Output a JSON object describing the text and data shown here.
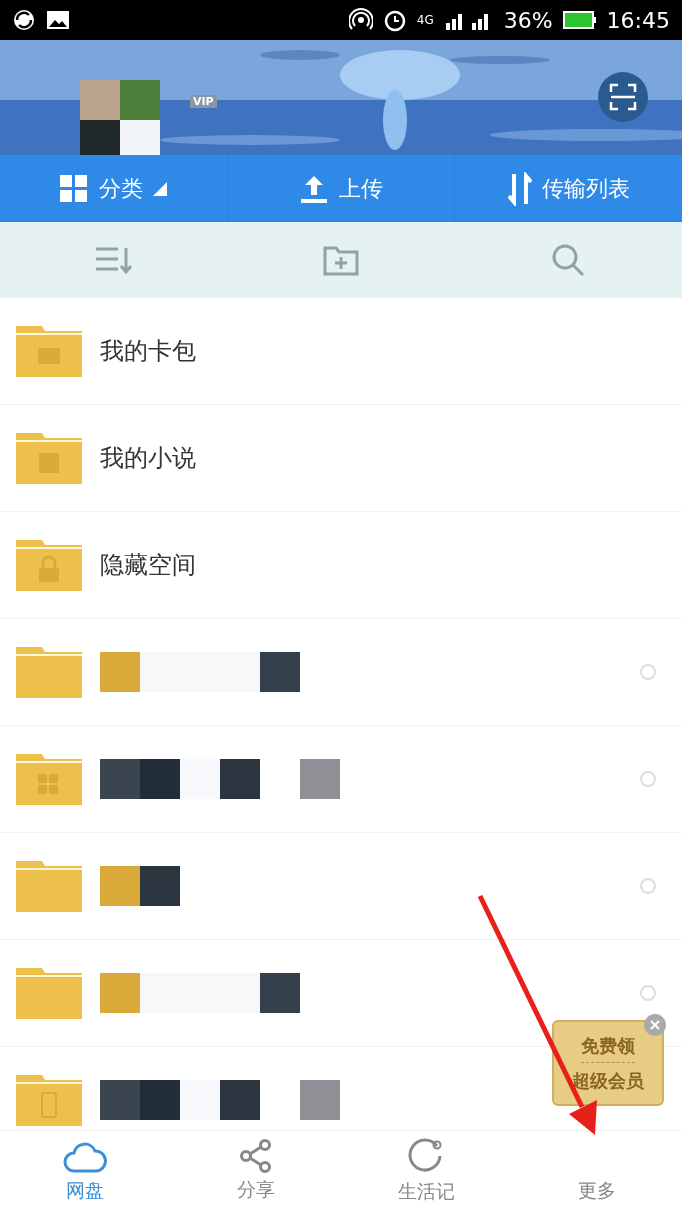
{
  "status_bar": {
    "network": "4G",
    "battery": "36%",
    "time": "16:45"
  },
  "header": {
    "kind": "picture",
    "badge": "VIP"
  },
  "action_bar": [
    {
      "label": "分类",
      "dropdown": true
    },
    {
      "label": "上传",
      "dropdown": false
    },
    {
      "label": "传输列表",
      "dropdown": false
    }
  ],
  "files": [
    {
      "kind": "wallet",
      "name": "我的卡包"
    },
    {
      "kind": "book",
      "name": "我的小说"
    },
    {
      "kind": "lock",
      "name": "隐藏空间"
    },
    {
      "kind": "plain",
      "checked": false
    },
    {
      "kind": "apps",
      "checked": false
    },
    {
      "kind": "plain",
      "checked": false
    },
    {
      "kind": "plain",
      "checked": false
    },
    {
      "kind": "phone"
    }
  ],
  "promo": {
    "lines": [
      "免费领",
      "超级会员"
    ]
  },
  "bottom_nav": [
    {
      "label": "网盘",
      "selected": true
    },
    {
      "label": "分享",
      "selected": false
    },
    {
      "label": "生活记",
      "selected": false
    },
    {
      "label": "更多",
      "selected": false
    }
  ]
}
